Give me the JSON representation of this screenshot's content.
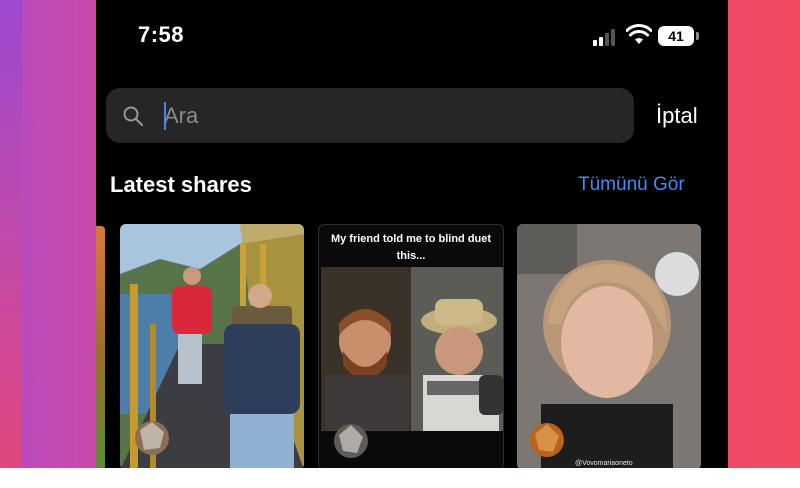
{
  "status_bar": {
    "time": "7:58",
    "battery_level": "41"
  },
  "search": {
    "placeholder": "Ara",
    "value": ""
  },
  "cancel_label": "İptal",
  "section": {
    "title": "Latest shares",
    "see_all_label": "Tümünü Gör"
  },
  "thumbnails": [
    {
      "caption": ""
    },
    {
      "caption": ""
    },
    {
      "caption": "My friend told me to blind duet this..."
    },
    {
      "caption": "@Vovomariaoneto"
    }
  ],
  "colors": {
    "accent_link": "#3d8df0",
    "search_bg": "#262626",
    "caret": "#4a86e8"
  }
}
